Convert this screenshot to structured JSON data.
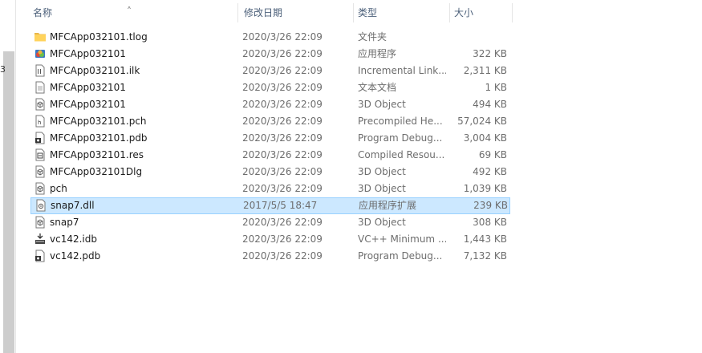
{
  "columns": {
    "name": "名称",
    "date": "修改日期",
    "type": "类型",
    "size": "大小"
  },
  "nav": {
    "glyph": "3"
  },
  "files": [
    {
      "name": "MFCApp032101.tlog",
      "date": "2020/3/26 22:09",
      "type": "文件夹",
      "size": "",
      "icon": "folder-icon"
    },
    {
      "name": "MFCApp032101",
      "date": "2020/3/26 22:09",
      "type": "应用程序",
      "size": "322 KB",
      "icon": "application-icon"
    },
    {
      "name": "MFCApp032101.ilk",
      "date": "2020/3/26 22:09",
      "type": "Incremental Link...",
      "size": "2,311 KB",
      "icon": "ilk-file-icon"
    },
    {
      "name": "MFCApp032101",
      "date": "2020/3/26 22:09",
      "type": "文本文档",
      "size": "1 KB",
      "icon": "text-file-icon"
    },
    {
      "name": "MFCApp032101",
      "date": "2020/3/26 22:09",
      "type": "3D Object",
      "size": "494 KB",
      "icon": "3d-object-icon"
    },
    {
      "name": "MFCApp032101.pch",
      "date": "2020/3/26 22:09",
      "type": "Precompiled He...",
      "size": "57,024 KB",
      "icon": "pch-file-icon"
    },
    {
      "name": "MFCApp032101.pdb",
      "date": "2020/3/26 22:09",
      "type": "Program Debug...",
      "size": "3,004 KB",
      "icon": "pdb-file-icon"
    },
    {
      "name": "MFCApp032101.res",
      "date": "2020/3/26 22:09",
      "type": "Compiled Resou...",
      "size": "69 KB",
      "icon": "res-file-icon"
    },
    {
      "name": "MFCApp032101Dlg",
      "date": "2020/3/26 22:09",
      "type": "3D Object",
      "size": "492 KB",
      "icon": "3d-object-icon"
    },
    {
      "name": "pch",
      "date": "2020/3/26 22:09",
      "type": "3D Object",
      "size": "1,039 KB",
      "icon": "3d-object-icon"
    },
    {
      "name": "snap7.dll",
      "date": "2017/5/5 18:47",
      "type": "应用程序扩展",
      "size": "239 KB",
      "icon": "dll-file-icon"
    },
    {
      "name": "snap7",
      "date": "2020/3/26 22:09",
      "type": "3D Object",
      "size": "308 KB",
      "icon": "3d-object-icon"
    },
    {
      "name": "vc142.idb",
      "date": "2020/3/26 22:09",
      "type": "VC++ Minimum ...",
      "size": "1,443 KB",
      "icon": "idb-file-icon"
    },
    {
      "name": "vc142.pdb",
      "date": "2020/3/26 22:09",
      "type": "Program Debug...",
      "size": "7,132 KB",
      "icon": "pdb-file-icon"
    }
  ],
  "selected_index": 10,
  "colors": {
    "header_text": "#4c607a",
    "selection_fill": "#cce8ff",
    "selection_border": "#99d1ff",
    "folder": "#ffd35c"
  }
}
